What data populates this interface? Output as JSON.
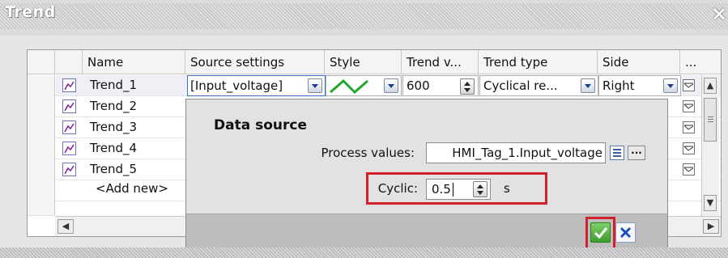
{
  "window": {
    "title": "Trend",
    "close_glyph": "✕"
  },
  "table": {
    "columns": [
      "Name",
      "Source settings",
      "Style",
      "Trend v...",
      "Trend type",
      "Side",
      "..."
    ],
    "rows": [
      {
        "name": "Trend_1",
        "source_settings": "[Input_voltage]",
        "trend_values": "600",
        "trend_type": "Cyclical re...",
        "side": "Right"
      },
      {
        "name": "Trend_2"
      },
      {
        "name": "Trend_3"
      },
      {
        "name": "Trend_4"
      },
      {
        "name": "Trend_5"
      },
      {
        "name": "<Add new>"
      }
    ]
  },
  "data_source": {
    "title": "Data source",
    "process_values_label": "Process values:",
    "process_values_value": "HMI_Tag_1.Input_voltage",
    "cyclic_label": "Cyclic:",
    "cyclic_value": "0.5",
    "cyclic_unit": "s"
  },
  "colors": {
    "accent_red": "#d3202c",
    "ok_green": "#4caf3a",
    "cancel_blue": "#1c4fbf",
    "style_line_green": "#1fa82a"
  },
  "icons": [
    "trend-icon",
    "dropdown-arrow-icon",
    "spinner-icon",
    "list-icon",
    "browse-icon",
    "ok-check-icon",
    "cancel-x-icon",
    "scroll-up-icon",
    "scroll-down-icon",
    "scroll-left-icon",
    "scroll-right-icon"
  ]
}
